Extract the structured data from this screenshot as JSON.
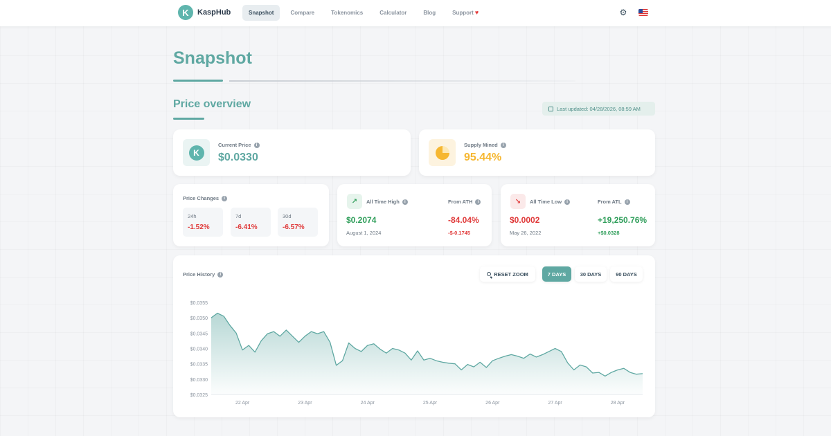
{
  "nav": {
    "logo_mark": "K",
    "logo_text": "KaspHub",
    "items": [
      "Snapshot",
      "Compare",
      "Tokenomics",
      "Calculator",
      "Blog",
      "Support"
    ],
    "active_index": 0,
    "heart": "♥",
    "gear": "⚙"
  },
  "page": {
    "title": "Snapshot",
    "section_title": "Price overview",
    "last_updated": "Last updated: 04/28/2026, 08:59 AM"
  },
  "current_price": {
    "label": "Current Price",
    "value": "$0.0330",
    "icon_mark": "K"
  },
  "supply_mined": {
    "label": "Supply Mined",
    "value": "95.44%"
  },
  "price_changes": {
    "label": "Price Changes",
    "items": [
      {
        "period": "24h",
        "value": "-1.52%"
      },
      {
        "period": "7d",
        "value": "-6.41%"
      },
      {
        "period": "30d",
        "value": "-6.57%"
      }
    ]
  },
  "ath": {
    "label": "All Time High",
    "value": "$0.2074",
    "date": "August 1, 2024",
    "from_label": "From ATH",
    "from_pct": "-84.04%",
    "from_abs": "-$-0.1745",
    "icon": "↗"
  },
  "atl": {
    "label": "All Time Low",
    "value": "$0.0002",
    "date": "May 26, 2022",
    "from_label": "From ATL",
    "from_pct": "+19,250.76%",
    "from_abs": "+$0.0328",
    "icon": "↘"
  },
  "history": {
    "label": "Price History",
    "reset_label": "RESET ZOOM",
    "ranges": [
      "7 DAYS",
      "30 DAYS",
      "90 DAYS"
    ],
    "active_range": 0
  },
  "colors": {
    "accent": "#5fa8a2",
    "line": "#5fa8a2",
    "positive": "#2f9e5a",
    "negative": "#e03a3a",
    "amber": "#f6b731"
  },
  "chart_data": {
    "type": "area",
    "title": "Price History",
    "xlabel": "",
    "ylabel": "",
    "ylim": [
      0.0325,
      0.0355
    ],
    "y_ticks": [
      0.0355,
      0.035,
      0.0345,
      0.034,
      0.0335,
      0.033,
      0.0325
    ],
    "y_tick_labels": [
      "$0.0355",
      "$0.0350",
      "$0.0345",
      "$0.0340",
      "$0.0335",
      "$0.0330",
      "$0.0325"
    ],
    "x_tick_labels": [
      "22 Apr",
      "23 Apr",
      "24 Apr",
      "25 Apr",
      "26 Apr",
      "27 Apr",
      "28 Apr"
    ],
    "x_tick_positions": [
      0.5,
      1.5,
      2.5,
      3.5,
      4.5,
      5.5,
      6.5
    ],
    "x_range": [
      0,
      6.9
    ],
    "grid": false,
    "series": [
      {
        "x": [
          0,
          0.1,
          0.2,
          0.3,
          0.4,
          0.5,
          0.6,
          0.7,
          0.8,
          0.9,
          1.0,
          1.1,
          1.2,
          1.3,
          1.4,
          1.5,
          1.6,
          1.7,
          1.8,
          1.9,
          2.0,
          2.1,
          2.2,
          2.3,
          2.4,
          2.5,
          2.6,
          2.7,
          2.8,
          2.9,
          3.0,
          3.1,
          3.2,
          3.3,
          3.4,
          3.5,
          3.6,
          3.7,
          3.8,
          3.9,
          4.0,
          4.1,
          4.2,
          4.3,
          4.4,
          4.5,
          4.6,
          4.7,
          4.8,
          4.9,
          5.0,
          5.1,
          5.2,
          5.3,
          5.4,
          5.5,
          5.6,
          5.7,
          5.8,
          5.9,
          6.0,
          6.1,
          6.2,
          6.3,
          6.4,
          6.5,
          6.6,
          6.7,
          6.8,
          6.9
        ],
        "y": [
          0.035,
          0.03515,
          0.03505,
          0.03475,
          0.0345,
          0.03395,
          0.0341,
          0.03388,
          0.03425,
          0.03448,
          0.03455,
          0.0344,
          0.0346,
          0.0344,
          0.0342,
          0.0344,
          0.03455,
          0.03448,
          0.03455,
          0.0342,
          0.03345,
          0.0336,
          0.03418,
          0.034,
          0.0339,
          0.0341,
          0.03415,
          0.03398,
          0.03385,
          0.034,
          0.03395,
          0.03385,
          0.03362,
          0.03392,
          0.03362,
          0.03368,
          0.0336,
          0.03355,
          0.03352,
          0.0335,
          0.0333,
          0.03348,
          0.0334,
          0.03355,
          0.03338,
          0.0336,
          0.03368,
          0.03375,
          0.0338,
          0.03375,
          0.03368,
          0.03382,
          0.03372,
          0.0338,
          0.0339,
          0.034,
          0.0339,
          0.03353,
          0.0333,
          0.03346,
          0.0334,
          0.0332,
          0.03322,
          0.0331,
          0.03322,
          0.0333,
          0.03335,
          0.03322,
          0.03316,
          0.03318
        ]
      }
    ]
  }
}
